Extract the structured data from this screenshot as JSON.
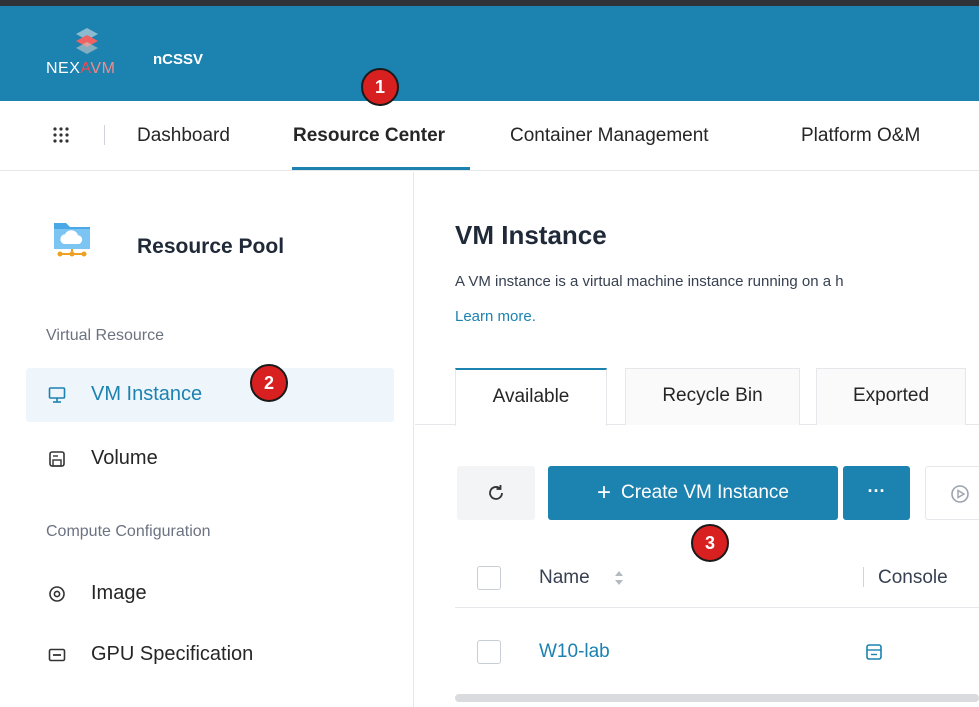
{
  "header": {
    "logo_text_a": "NEX",
    "logo_text_b": "A",
    "logo_text_c": "VM",
    "app_name": "nCSSV",
    "brand_color": "#1c82b0"
  },
  "nav": {
    "items": [
      {
        "label": "Dashboard"
      },
      {
        "label": "Resource Center"
      },
      {
        "label": "Container Management"
      },
      {
        "label": "Platform O&M"
      }
    ],
    "active": "Resource Center"
  },
  "sidebar": {
    "title": "Resource Pool",
    "groups": [
      {
        "label": "Virtual Resource"
      },
      {
        "label": "Compute Configuration"
      }
    ],
    "items": [
      {
        "label": "VM Instance",
        "icon": "monitor-icon",
        "active": true
      },
      {
        "label": "Volume",
        "icon": "volume-icon"
      },
      {
        "label": "Image",
        "icon": "image-disc-icon"
      },
      {
        "label": "GPU Specification",
        "icon": "gpu-icon"
      }
    ]
  },
  "main": {
    "title": "VM Instance",
    "description": "A VM instance is a virtual machine instance running on a h",
    "learn_more": "Learn more.",
    "tabs": [
      {
        "label": "Available",
        "active": true
      },
      {
        "label": "Recycle Bin"
      },
      {
        "label": "Exported"
      }
    ],
    "toolbar": {
      "create_plus": "+",
      "create_label": "Create VM Instance",
      "more_label": "···"
    },
    "table": {
      "columns": [
        "Name",
        "Console"
      ],
      "rows": [
        {
          "name": "W10-lab"
        }
      ]
    }
  },
  "markers": [
    "1",
    "2",
    "3"
  ]
}
